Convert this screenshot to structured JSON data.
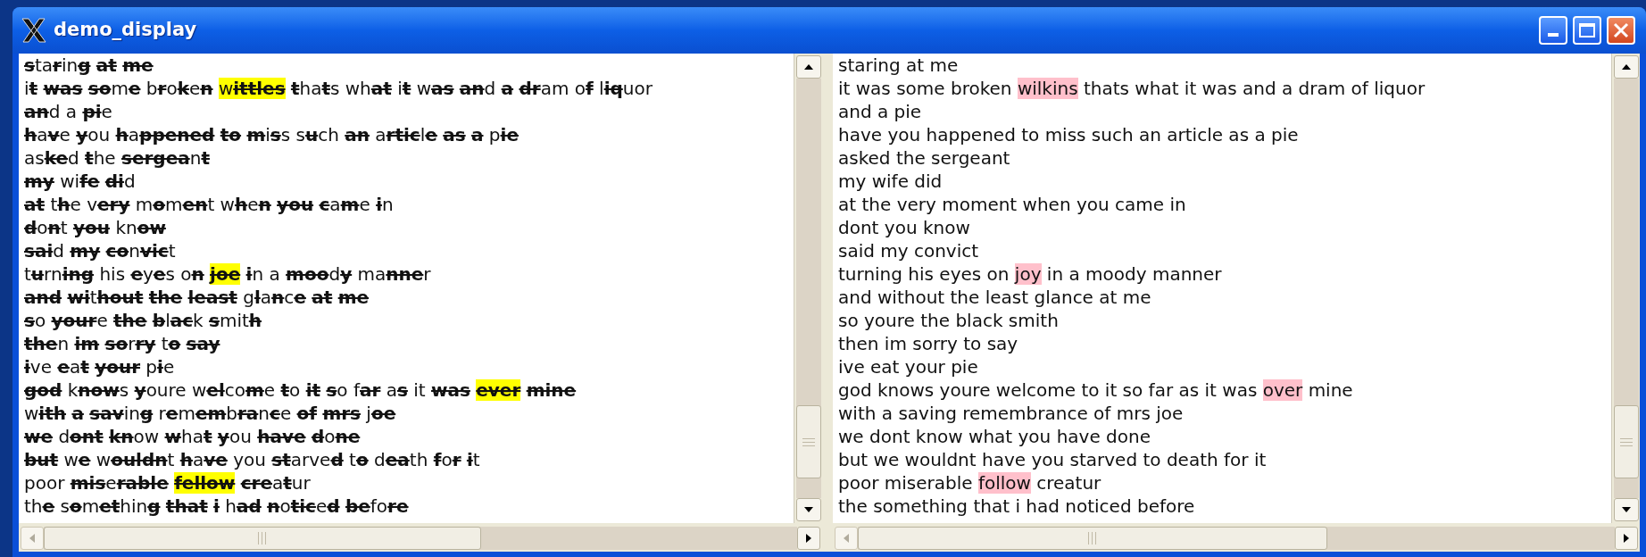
{
  "window": {
    "title": "demo_display"
  },
  "left_pane": {
    "lines": [
      {
        "segments": [
          {
            "text": "s",
            "kind": "struck"
          },
          {
            "text": "ta",
            "kind": "plain"
          },
          {
            "text": "r",
            "kind": "struck"
          },
          {
            "text": "in",
            "kind": "plain"
          },
          {
            "text": "g ",
            "kind": "struck"
          },
          {
            "text": "at ",
            "kind": "struck"
          },
          {
            "text": "me",
            "kind": "struck"
          }
        ]
      },
      {
        "segments": [
          {
            "text": "i",
            "kind": "plain"
          },
          {
            "text": "t ",
            "kind": "struck"
          },
          {
            "text": "was ",
            "kind": "struck"
          },
          {
            "text": "so",
            "kind": "struck"
          },
          {
            "text": "m",
            "kind": "plain"
          },
          {
            "text": "e",
            "kind": "struck"
          },
          {
            "text": " b",
            "kind": "plain"
          },
          {
            "text": "r",
            "kind": "struck"
          },
          {
            "text": "o",
            "kind": "plain"
          },
          {
            "text": "k",
            "kind": "struck"
          },
          {
            "text": "e",
            "kind": "plain"
          },
          {
            "text": "n ",
            "kind": "struck"
          },
          {
            "text": "w",
            "kind": "highlighted"
          },
          {
            "text": "ittles ",
            "kind": "highlighted_struck"
          },
          {
            "text": "t",
            "kind": "struck"
          },
          {
            "text": "ha",
            "kind": "plain"
          },
          {
            "text": "t",
            "kind": "struck"
          },
          {
            "text": "s wh",
            "kind": "plain"
          },
          {
            "text": "at",
            "kind": "struck"
          },
          {
            "text": " i",
            "kind": "plain"
          },
          {
            "text": "t",
            "kind": "struck"
          },
          {
            "text": " w",
            "kind": "plain"
          },
          {
            "text": "as ",
            "kind": "struck"
          },
          {
            "text": "an",
            "kind": "struck"
          },
          {
            "text": "d ",
            "kind": "plain"
          },
          {
            "text": "a ",
            "kind": "struck"
          },
          {
            "text": "dr",
            "kind": "struck"
          },
          {
            "text": "am o",
            "kind": "plain"
          },
          {
            "text": "f",
            "kind": "struck"
          },
          {
            "text": " l",
            "kind": "plain"
          },
          {
            "text": "iq",
            "kind": "struck"
          },
          {
            "text": "uor",
            "kind": "plain"
          }
        ]
      },
      {
        "segments": [
          {
            "text": "an",
            "kind": "struck"
          },
          {
            "text": "d a ",
            "kind": "plain"
          },
          {
            "text": "pi",
            "kind": "struck"
          },
          {
            "text": "e",
            "kind": "plain"
          }
        ]
      },
      {
        "segments": [
          {
            "text": "h",
            "kind": "struck"
          },
          {
            "text": "a",
            "kind": "plain"
          },
          {
            "text": "v",
            "kind": "struck"
          },
          {
            "text": "e ",
            "kind": "plain"
          },
          {
            "text": "y",
            "kind": "struck"
          },
          {
            "text": "ou ",
            "kind": "plain"
          },
          {
            "text": "h",
            "kind": "struck"
          },
          {
            "text": "a",
            "kind": "plain"
          },
          {
            "text": "ppened ",
            "kind": "struck"
          },
          {
            "text": "to ",
            "kind": "struck"
          },
          {
            "text": "m",
            "kind": "struck"
          },
          {
            "text": "i",
            "kind": "plain"
          },
          {
            "text": "s",
            "kind": "struck"
          },
          {
            "text": "s s",
            "kind": "plain"
          },
          {
            "text": "u",
            "kind": "struck"
          },
          {
            "text": "ch ",
            "kind": "plain"
          },
          {
            "text": "an",
            "kind": "struck"
          },
          {
            "text": " a",
            "kind": "plain"
          },
          {
            "text": "rtic",
            "kind": "struck"
          },
          {
            "text": "l",
            "kind": "plain"
          },
          {
            "text": "e ",
            "kind": "struck"
          },
          {
            "text": "as ",
            "kind": "struck"
          },
          {
            "text": "a",
            "kind": "struck"
          },
          {
            "text": " p",
            "kind": "plain"
          },
          {
            "text": "ie",
            "kind": "struck"
          }
        ]
      },
      {
        "segments": [
          {
            "text": "as",
            "kind": "plain"
          },
          {
            "text": "ke",
            "kind": "struck"
          },
          {
            "text": "d ",
            "kind": "plain"
          },
          {
            "text": "t",
            "kind": "struck"
          },
          {
            "text": "he ",
            "kind": "plain"
          },
          {
            "text": "sergea",
            "kind": "struck"
          },
          {
            "text": "n",
            "kind": "plain"
          },
          {
            "text": "t",
            "kind": "struck"
          }
        ]
      },
      {
        "segments": [
          {
            "text": "my",
            "kind": "struck"
          },
          {
            "text": " wi",
            "kind": "plain"
          },
          {
            "text": "fe ",
            "kind": "struck"
          },
          {
            "text": "di",
            "kind": "struck"
          },
          {
            "text": "d",
            "kind": "plain"
          }
        ]
      },
      {
        "segments": [
          {
            "text": "at",
            "kind": "struck"
          },
          {
            "text": " t",
            "kind": "plain"
          },
          {
            "text": "h",
            "kind": "struck"
          },
          {
            "text": "e v",
            "kind": "plain"
          },
          {
            "text": "ery",
            "kind": "struck"
          },
          {
            "text": " m",
            "kind": "plain"
          },
          {
            "text": "o",
            "kind": "struck"
          },
          {
            "text": "m",
            "kind": "plain"
          },
          {
            "text": "en",
            "kind": "struck"
          },
          {
            "text": "t w",
            "kind": "plain"
          },
          {
            "text": "h",
            "kind": "struck"
          },
          {
            "text": "e",
            "kind": "plain"
          },
          {
            "text": "n ",
            "kind": "struck"
          },
          {
            "text": "you ",
            "kind": "struck"
          },
          {
            "text": "c",
            "kind": "struck"
          },
          {
            "text": "a",
            "kind": "plain"
          },
          {
            "text": "m",
            "kind": "struck"
          },
          {
            "text": "e ",
            "kind": "plain"
          },
          {
            "text": "i",
            "kind": "struck"
          },
          {
            "text": "n",
            "kind": "plain"
          }
        ]
      },
      {
        "segments": [
          {
            "text": "d",
            "kind": "struck"
          },
          {
            "text": "o",
            "kind": "plain"
          },
          {
            "text": "n",
            "kind": "struck"
          },
          {
            "text": "t ",
            "kind": "plain"
          },
          {
            "text": "you",
            "kind": "struck"
          },
          {
            "text": " kn",
            "kind": "plain"
          },
          {
            "text": "ow",
            "kind": "struck"
          }
        ]
      },
      {
        "segments": [
          {
            "text": "sai",
            "kind": "struck"
          },
          {
            "text": "d ",
            "kind": "plain"
          },
          {
            "text": "my ",
            "kind": "struck"
          },
          {
            "text": "co",
            "kind": "struck"
          },
          {
            "text": "n",
            "kind": "plain"
          },
          {
            "text": "vic",
            "kind": "struck"
          },
          {
            "text": "t",
            "kind": "plain"
          }
        ]
      },
      {
        "segments": [
          {
            "text": "t",
            "kind": "plain"
          },
          {
            "text": "u",
            "kind": "struck"
          },
          {
            "text": "rn",
            "kind": "plain"
          },
          {
            "text": "ing",
            "kind": "struck"
          },
          {
            "text": " his ",
            "kind": "plain"
          },
          {
            "text": "e",
            "kind": "struck"
          },
          {
            "text": "y",
            "kind": "plain"
          },
          {
            "text": "e",
            "kind": "struck"
          },
          {
            "text": "s o",
            "kind": "plain"
          },
          {
            "text": "n ",
            "kind": "struck"
          },
          {
            "text": "joe ",
            "kind": "highlighted_struck"
          },
          {
            "text": "i",
            "kind": "struck"
          },
          {
            "text": "n a ",
            "kind": "plain"
          },
          {
            "text": "moo",
            "kind": "struck"
          },
          {
            "text": "d",
            "kind": "plain"
          },
          {
            "text": "y",
            "kind": "struck"
          },
          {
            "text": " ma",
            "kind": "plain"
          },
          {
            "text": "nne",
            "kind": "struck"
          },
          {
            "text": "r",
            "kind": "plain"
          }
        ]
      },
      {
        "segments": [
          {
            "text": "and ",
            "kind": "struck"
          },
          {
            "text": "wi",
            "kind": "struck"
          },
          {
            "text": "t",
            "kind": "plain"
          },
          {
            "text": "hout ",
            "kind": "struck"
          },
          {
            "text": "the ",
            "kind": "struck"
          },
          {
            "text": "least",
            "kind": "struck"
          },
          {
            "text": " g",
            "kind": "plain"
          },
          {
            "text": "l",
            "kind": "struck"
          },
          {
            "text": "a",
            "kind": "plain"
          },
          {
            "text": "n",
            "kind": "struck"
          },
          {
            "text": "c",
            "kind": "plain"
          },
          {
            "text": "e ",
            "kind": "struck"
          },
          {
            "text": "at ",
            "kind": "struck"
          },
          {
            "text": "me",
            "kind": "struck"
          }
        ]
      },
      {
        "segments": [
          {
            "text": "s",
            "kind": "struck"
          },
          {
            "text": "o ",
            "kind": "plain"
          },
          {
            "text": "your",
            "kind": "struck"
          },
          {
            "text": "e ",
            "kind": "plain"
          },
          {
            "text": "the ",
            "kind": "struck"
          },
          {
            "text": "b",
            "kind": "struck"
          },
          {
            "text": "l",
            "kind": "plain"
          },
          {
            "text": "ac",
            "kind": "struck"
          },
          {
            "text": "k ",
            "kind": "plain"
          },
          {
            "text": "s",
            "kind": "struck"
          },
          {
            "text": "mit",
            "kind": "plain"
          },
          {
            "text": "h",
            "kind": "struck"
          }
        ]
      },
      {
        "segments": [
          {
            "text": "the",
            "kind": "struck"
          },
          {
            "text": "n ",
            "kind": "plain"
          },
          {
            "text": "im ",
            "kind": "struck"
          },
          {
            "text": "so",
            "kind": "struck"
          },
          {
            "text": "r",
            "kind": "plain"
          },
          {
            "text": "ry",
            "kind": "struck"
          },
          {
            "text": " t",
            "kind": "plain"
          },
          {
            "text": "o ",
            "kind": "struck"
          },
          {
            "text": "say",
            "kind": "struck"
          }
        ]
      },
      {
        "segments": [
          {
            "text": "i",
            "kind": "struck"
          },
          {
            "text": "ve ",
            "kind": "plain"
          },
          {
            "text": "e",
            "kind": "struck"
          },
          {
            "text": "a",
            "kind": "plain"
          },
          {
            "text": "t ",
            "kind": "struck"
          },
          {
            "text": "your",
            "kind": "struck"
          },
          {
            "text": " p",
            "kind": "plain"
          },
          {
            "text": "i",
            "kind": "struck"
          },
          {
            "text": "e",
            "kind": "plain"
          }
        ]
      },
      {
        "segments": [
          {
            "text": "god",
            "kind": "struck"
          },
          {
            "text": " k",
            "kind": "plain"
          },
          {
            "text": "now",
            "kind": "struck"
          },
          {
            "text": "s ",
            "kind": "plain"
          },
          {
            "text": "y",
            "kind": "struck"
          },
          {
            "text": "oure w",
            "kind": "plain"
          },
          {
            "text": "el",
            "kind": "struck"
          },
          {
            "text": "co",
            "kind": "plain"
          },
          {
            "text": "m",
            "kind": "struck"
          },
          {
            "text": "e ",
            "kind": "plain"
          },
          {
            "text": "t",
            "kind": "struck"
          },
          {
            "text": "o ",
            "kind": "plain"
          },
          {
            "text": "it ",
            "kind": "struck"
          },
          {
            "text": "s",
            "kind": "struck"
          },
          {
            "text": "o f",
            "kind": "plain"
          },
          {
            "text": "ar",
            "kind": "struck"
          },
          {
            "text": " a",
            "kind": "plain"
          },
          {
            "text": "s",
            "kind": "struck"
          },
          {
            "text": " it ",
            "kind": "plain"
          },
          {
            "text": "was ",
            "kind": "struck"
          },
          {
            "text": "ever ",
            "kind": "highlighted_struck"
          },
          {
            "text": "mine",
            "kind": "struck"
          }
        ]
      },
      {
        "segments": [
          {
            "text": "w",
            "kind": "plain"
          },
          {
            "text": "ith ",
            "kind": "struck"
          },
          {
            "text": "a ",
            "kind": "struck"
          },
          {
            "text": "sav",
            "kind": "struck"
          },
          {
            "text": "in",
            "kind": "plain"
          },
          {
            "text": "g",
            "kind": "struck"
          },
          {
            "text": " r",
            "kind": "plain"
          },
          {
            "text": "e",
            "kind": "struck"
          },
          {
            "text": "m",
            "kind": "plain"
          },
          {
            "text": "em",
            "kind": "struck"
          },
          {
            "text": "b",
            "kind": "plain"
          },
          {
            "text": "ra",
            "kind": "struck"
          },
          {
            "text": "n",
            "kind": "plain"
          },
          {
            "text": "c",
            "kind": "struck"
          },
          {
            "text": "e ",
            "kind": "plain"
          },
          {
            "text": "of ",
            "kind": "struck"
          },
          {
            "text": "mrs",
            "kind": "struck"
          },
          {
            "text": " j",
            "kind": "plain"
          },
          {
            "text": "oe",
            "kind": "struck"
          }
        ]
      },
      {
        "segments": [
          {
            "text": "we",
            "kind": "struck"
          },
          {
            "text": " d",
            "kind": "plain"
          },
          {
            "text": "ont ",
            "kind": "struck"
          },
          {
            "text": "kn",
            "kind": "struck"
          },
          {
            "text": "ow ",
            "kind": "plain"
          },
          {
            "text": "w",
            "kind": "struck"
          },
          {
            "text": "ha",
            "kind": "plain"
          },
          {
            "text": "t ",
            "kind": "struck"
          },
          {
            "text": "y",
            "kind": "struck"
          },
          {
            "text": "ou ",
            "kind": "plain"
          },
          {
            "text": "have ",
            "kind": "struck"
          },
          {
            "text": "d",
            "kind": "struck"
          },
          {
            "text": "o",
            "kind": "plain"
          },
          {
            "text": "ne",
            "kind": "struck"
          }
        ]
      },
      {
        "segments": [
          {
            "text": "but",
            "kind": "struck"
          },
          {
            "text": " w",
            "kind": "plain"
          },
          {
            "text": "e",
            "kind": "struck"
          },
          {
            "text": " w",
            "kind": "plain"
          },
          {
            "text": "ouldn",
            "kind": "struck"
          },
          {
            "text": "t ",
            "kind": "plain"
          },
          {
            "text": "h",
            "kind": "struck"
          },
          {
            "text": "a",
            "kind": "plain"
          },
          {
            "text": "ve",
            "kind": "struck"
          },
          {
            "text": " you ",
            "kind": "plain"
          },
          {
            "text": "st",
            "kind": "struck"
          },
          {
            "text": "arve",
            "kind": "plain"
          },
          {
            "text": "d",
            "kind": "struck"
          },
          {
            "text": " t",
            "kind": "plain"
          },
          {
            "text": "o",
            "kind": "struck"
          },
          {
            "text": " d",
            "kind": "plain"
          },
          {
            "text": "ea",
            "kind": "struck"
          },
          {
            "text": "th ",
            "kind": "plain"
          },
          {
            "text": "f",
            "kind": "struck"
          },
          {
            "text": "o",
            "kind": "plain"
          },
          {
            "text": "r ",
            "kind": "struck"
          },
          {
            "text": "i",
            "kind": "struck"
          },
          {
            "text": "t",
            "kind": "plain"
          }
        ]
      },
      {
        "segments": [
          {
            "text": "poor ",
            "kind": "plain"
          },
          {
            "text": "mis",
            "kind": "struck"
          },
          {
            "text": "e",
            "kind": "plain"
          },
          {
            "text": "rable ",
            "kind": "struck"
          },
          {
            "text": "fellow ",
            "kind": "highlighted_struck"
          },
          {
            "text": "cre",
            "kind": "struck"
          },
          {
            "text": "a",
            "kind": "plain"
          },
          {
            "text": "t",
            "kind": "struck"
          },
          {
            "text": "ur",
            "kind": "plain"
          }
        ]
      },
      {
        "segments": [
          {
            "text": "th",
            "kind": "plain"
          },
          {
            "text": "e",
            "kind": "struck"
          },
          {
            "text": " s",
            "kind": "plain"
          },
          {
            "text": "o",
            "kind": "struck"
          },
          {
            "text": "m",
            "kind": "plain"
          },
          {
            "text": "et",
            "kind": "struck"
          },
          {
            "text": "hin",
            "kind": "plain"
          },
          {
            "text": "g ",
            "kind": "struck"
          },
          {
            "text": "that ",
            "kind": "struck"
          },
          {
            "text": "i",
            "kind": "struck"
          },
          {
            "text": " h",
            "kind": "plain"
          },
          {
            "text": "ad ",
            "kind": "struck"
          },
          {
            "text": "n",
            "kind": "struck"
          },
          {
            "text": "o",
            "kind": "plain"
          },
          {
            "text": "tic",
            "kind": "struck"
          },
          {
            "text": "e",
            "kind": "plain"
          },
          {
            "text": "d ",
            "kind": "struck"
          },
          {
            "text": "be",
            "kind": "struck"
          },
          {
            "text": "fo",
            "kind": "plain"
          },
          {
            "text": "re",
            "kind": "struck"
          }
        ]
      }
    ]
  },
  "right_pane": {
    "lines": [
      {
        "segments": [
          {
            "text": "staring at me",
            "kind": "plain"
          }
        ]
      },
      {
        "segments": [
          {
            "text": "it was some broken ",
            "kind": "plain"
          },
          {
            "text": "wilkins",
            "kind": "highlighted"
          },
          {
            "text": " thats what it was and a dram of liquor",
            "kind": "plain"
          }
        ]
      },
      {
        "segments": [
          {
            "text": "and a pie",
            "kind": "plain"
          }
        ]
      },
      {
        "segments": [
          {
            "text": "have you happened to miss such an article as a pie",
            "kind": "plain"
          }
        ]
      },
      {
        "segments": [
          {
            "text": "asked the sergeant",
            "kind": "plain"
          }
        ]
      },
      {
        "segments": [
          {
            "text": "my wife did",
            "kind": "plain"
          }
        ]
      },
      {
        "segments": [
          {
            "text": "at the very moment when you came in",
            "kind": "plain"
          }
        ]
      },
      {
        "segments": [
          {
            "text": "dont you know",
            "kind": "plain"
          }
        ]
      },
      {
        "segments": [
          {
            "text": "said my convict",
            "kind": "plain"
          }
        ]
      },
      {
        "segments": [
          {
            "text": "turning his eyes on ",
            "kind": "plain"
          },
          {
            "text": "joy",
            "kind": "highlighted"
          },
          {
            "text": " in a moody manner",
            "kind": "plain"
          }
        ]
      },
      {
        "segments": [
          {
            "text": "and without the least glance at me",
            "kind": "plain"
          }
        ]
      },
      {
        "segments": [
          {
            "text": "so youre the black smith",
            "kind": "plain"
          }
        ]
      },
      {
        "segments": [
          {
            "text": "then im sorry to say",
            "kind": "plain"
          }
        ]
      },
      {
        "segments": [
          {
            "text": "ive eat your pie",
            "kind": "plain"
          }
        ]
      },
      {
        "segments": [
          {
            "text": "god knows youre welcome to it so far as it was ",
            "kind": "plain"
          },
          {
            "text": "over",
            "kind": "highlighted"
          },
          {
            "text": " mine",
            "kind": "plain"
          }
        ]
      },
      {
        "segments": [
          {
            "text": "with a saving remembrance of mrs joe",
            "kind": "plain"
          }
        ]
      },
      {
        "segments": [
          {
            "text": "we dont know what you have done",
            "kind": "plain"
          }
        ]
      },
      {
        "segments": [
          {
            "text": "but we wouldnt have you starved to death for it",
            "kind": "plain"
          }
        ]
      },
      {
        "segments": [
          {
            "text": "poor miserable ",
            "kind": "plain"
          },
          {
            "text": "follow",
            "kind": "highlighted"
          },
          {
            "text": " creatur",
            "kind": "plain"
          }
        ]
      },
      {
        "segments": [
          {
            "text": "the something that i had noticed before",
            "kind": "plain"
          }
        ]
      }
    ]
  }
}
